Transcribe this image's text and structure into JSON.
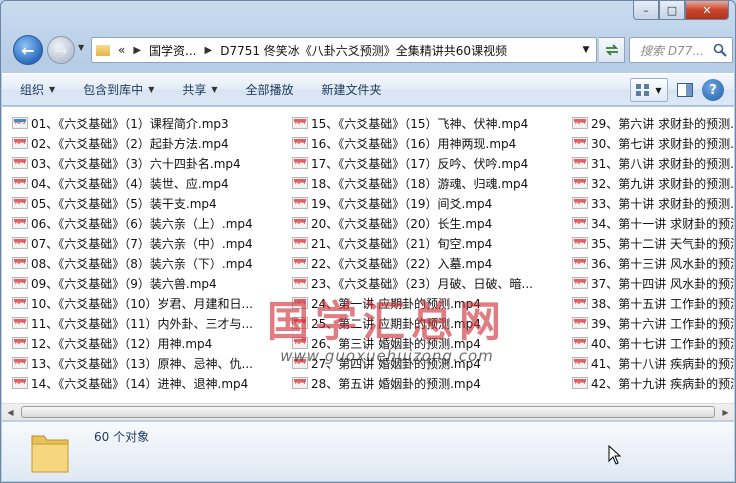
{
  "window": {
    "caption_buttons": {
      "minimize": "–",
      "maximize": "□",
      "close": "✕"
    }
  },
  "nav": {
    "back_glyph": "←",
    "forward_glyph": "→",
    "address_prefix": "«",
    "crumbs": [
      "国学资...",
      "D7751 佟笑冰《八卦六爻预测》全集精讲共60课视频"
    ],
    "search_placeholder": "搜索 D77..."
  },
  "toolbar": {
    "organize": "组织",
    "include_library": "包含到库中",
    "share": "共享",
    "play_all": "全部播放",
    "new_folder": "新建文件夹"
  },
  "columns": [
    {
      "files": [
        {
          "name": "01、《六爻基础》（1）课程简介.mp3",
          "type": "mp3"
        },
        {
          "name": "02、《六爻基础》（2）起卦方法.mp4",
          "type": "mp4"
        },
        {
          "name": "03、《六爻基础》（3）六十四卦名.mp4",
          "type": "mp4"
        },
        {
          "name": "04、《六爻基础》（4）装世、应.mp4",
          "type": "mp4"
        },
        {
          "name": "05、《六爻基础》（5）装干支.mp4",
          "type": "mp4"
        },
        {
          "name": "06、《六爻基础》（6）装六亲（上）.mp4",
          "type": "mp4"
        },
        {
          "name": "07、《六爻基础》（7）装六亲（中）.mp4",
          "type": "mp4"
        },
        {
          "name": "08、《六爻基础》（8）装六亲（下）.mp4",
          "type": "mp4"
        },
        {
          "name": "09、《六爻基础》（9）装六兽.mp4",
          "type": "mp4"
        },
        {
          "name": "10、《六爻基础》（10）岁君、月建和日...",
          "type": "mp4"
        },
        {
          "name": "11、《六爻基础》（11）内外卦、三才与...",
          "type": "mp4"
        },
        {
          "name": "12、《六爻基础》（12）用神.mp4",
          "type": "mp4"
        },
        {
          "name": "13、《六爻基础》（13）原神、忌神、仇...",
          "type": "mp4"
        },
        {
          "name": "14、《六爻基础》（14）进神、退神.mp4",
          "type": "mp4"
        }
      ]
    },
    {
      "files": [
        {
          "name": "15、《六爻基础》（15）飞神、伏神.mp4",
          "type": "mp4"
        },
        {
          "name": "16、《六爻基础》（16）用神两现.mp4",
          "type": "mp4"
        },
        {
          "name": "17、《六爻基础》（17）反吟、伏吟.mp4",
          "type": "mp4"
        },
        {
          "name": "18、《六爻基础》（18）游魂、归魂.mp4",
          "type": "mp4"
        },
        {
          "name": "19、《六爻基础》（19）间爻.mp4",
          "type": "mp4"
        },
        {
          "name": "20、《六爻基础》（20）长生.mp4",
          "type": "mp4"
        },
        {
          "name": "21、《六爻基础》（21）旬空.mp4",
          "type": "mp4"
        },
        {
          "name": "22、《六爻基础》（22）入墓.mp4",
          "type": "mp4"
        },
        {
          "name": "23、《六爻基础》（23）月破、日破、暗...",
          "type": "mp4"
        },
        {
          "name": "24、第一讲 应期卦的预测.mp4",
          "type": "mp4"
        },
        {
          "name": "25、第二讲 应期卦的预测.mp4",
          "type": "mp4"
        },
        {
          "name": "26、第三讲 婚姻卦的预测.mp4",
          "type": "mp4"
        },
        {
          "name": "27、第四讲 婚姻卦的预测.mp4",
          "type": "mp4"
        },
        {
          "name": "28、第五讲 婚姻卦的预测.mp4",
          "type": "mp4"
        }
      ]
    },
    {
      "files": [
        {
          "name": "29、第六讲 求财卦的预测.mp4",
          "type": "mp4"
        },
        {
          "name": "30、第七讲 求财卦的预测.mp4",
          "type": "mp4"
        },
        {
          "name": "31、第八讲 求财卦的预测.mp4",
          "type": "mp4"
        },
        {
          "name": "32、第九讲 求财卦的预测.mp4",
          "type": "mp4"
        },
        {
          "name": "33、第十讲 求财卦的预测.mp4",
          "type": "mp4"
        },
        {
          "name": "34、第十一讲 求财卦的预测.mp4",
          "type": "mp4"
        },
        {
          "name": "35、第十二讲 天气卦的预测.mp4",
          "type": "mp4"
        },
        {
          "name": "36、第十三讲 风水卦的预测.mp4",
          "type": "mp4"
        },
        {
          "name": "37、第十四讲 风水卦的预测.mp4",
          "type": "mp4"
        },
        {
          "name": "38、第十五讲 工作卦的预测.mp4",
          "type": "mp4"
        },
        {
          "name": "39、第十六讲 工作卦的预测.mp4",
          "type": "mp4"
        },
        {
          "name": "40、第十七讲 工作卦的预测.mp4",
          "type": "mp4"
        },
        {
          "name": "41、第十八讲 疾病卦的预测.mp4",
          "type": "mp4"
        },
        {
          "name": "42、第十九讲 疾病卦的预测.mp4",
          "type": "mp4"
        }
      ]
    }
  ],
  "icon_badge": {
    "mp4": "MP4",
    "mp3": "MP3"
  },
  "watermark": {
    "text": "国学汇总网",
    "url": "www.guoxuehuizong.com"
  },
  "status": {
    "object_count": "60 个对象"
  }
}
